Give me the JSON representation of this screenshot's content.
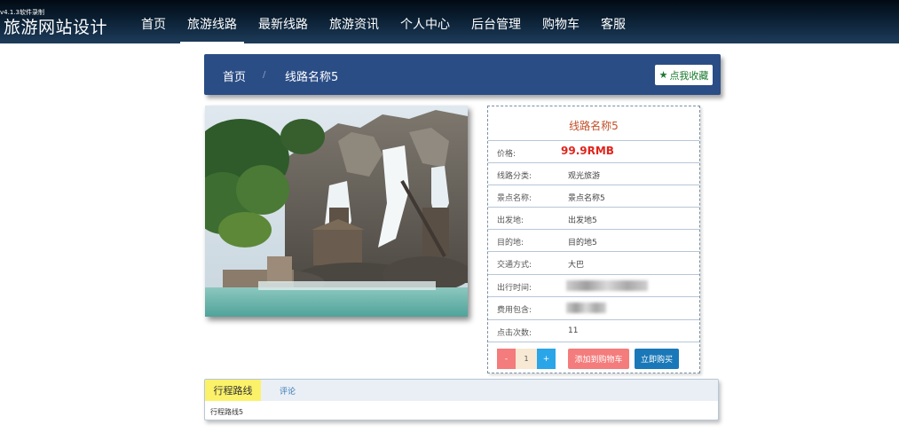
{
  "overlay": {
    "recording_label": "v4.1.3软件录制"
  },
  "header": {
    "brand": "旅游网站设计",
    "nav": [
      "首页",
      "旅游线路",
      "最新线路",
      "旅游资讯",
      "个人中心",
      "后台管理",
      "购物车",
      "客服"
    ],
    "active_nav": "旅游线路"
  },
  "breadcrumb": {
    "home": "首页",
    "separator": "/",
    "current": "线路名称5"
  },
  "favorite_button": {
    "label": "点我收藏",
    "icon": "star-icon",
    "color": "#1a7a2e"
  },
  "detail": {
    "title": "线路名称5",
    "price_label": "价格:",
    "price": "99.9RMB",
    "rows": [
      {
        "label": "线路分类:",
        "value": "观光旅游"
      },
      {
        "label": "景点名称:",
        "value": "景点名称5"
      },
      {
        "label": "出发地:",
        "value": "出发地5"
      },
      {
        "label": "目的地:",
        "value": "目的地5"
      },
      {
        "label": "交通方式:",
        "value": "大巴"
      },
      {
        "label": "出行时间:",
        "value": ""
      },
      {
        "label": "费用包含:",
        "value": ""
      },
      {
        "label": "点击次数:",
        "value": "11"
      }
    ]
  },
  "purchase": {
    "minus": "-",
    "quantity": "1",
    "plus": "+",
    "add_to_cart": "添加到购物车",
    "buy_now": "立即购买"
  },
  "tabs": {
    "items": [
      "行程路线",
      "评论"
    ],
    "active": "行程路线",
    "content": "行程路线5"
  },
  "colors": {
    "nav_bg": "#0b2034",
    "breadcrumb_bg": "#2b4d86",
    "price": "#e0251c",
    "title": "#c0502a",
    "cart": "#f47c7c",
    "buy": "#1a78b8",
    "active_tab": "#fbf26a"
  }
}
